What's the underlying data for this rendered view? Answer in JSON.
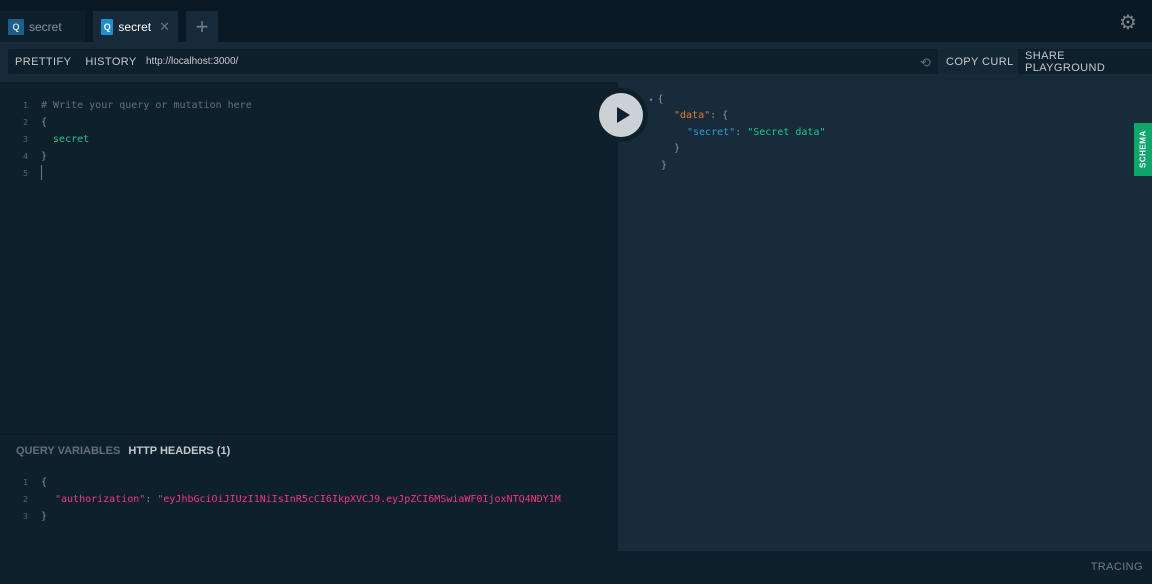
{
  "tabs": [
    {
      "icon": "Q",
      "label": "secret"
    },
    {
      "icon": "Q",
      "label": "secret",
      "close": "✕"
    }
  ],
  "new_tab": "+",
  "settings_icon": "gear-icon",
  "toolbar": {
    "prettify": "PRETTIFY",
    "history": "HISTORY",
    "url": "http://localhost:3000/",
    "reload_icon": "⟲",
    "copy_curl": "COPY CURL",
    "share": "SHARE PLAYGROUND"
  },
  "editor": {
    "lines": [
      {
        "n": "1",
        "text": "# Write your query or mutation here"
      },
      {
        "n": "2",
        "text": "{"
      },
      {
        "n": "3",
        "text": "  secret"
      },
      {
        "n": "4",
        "text": "}"
      },
      {
        "n": "5",
        "text": ""
      }
    ]
  },
  "result": {
    "open": "{",
    "data_key": "\"data\"",
    "colon": ": {",
    "secret_key": "\"secret\"",
    "secret_value": "\"Secret data\"",
    "close_inner": "}",
    "close_outer": "}"
  },
  "schema_tab": "SCHEMA",
  "variables": {
    "tabs": [
      "QUERY VARIABLES",
      "HTTP HEADERS (1)"
    ],
    "lines": [
      {
        "n": "1",
        "text": "{"
      },
      {
        "n": "2",
        "key": "\"authorization\"",
        "value": "\"eyJhbGciOiJIUzI1NiIsInR5cCI6IkpXVCJ9.eyJpZCI6MSwiaWF0IjoxNTQ4NDY1M"
      },
      {
        "n": "3",
        "text": "}"
      }
    ]
  },
  "footer": {
    "tracing": "TRACING"
  }
}
